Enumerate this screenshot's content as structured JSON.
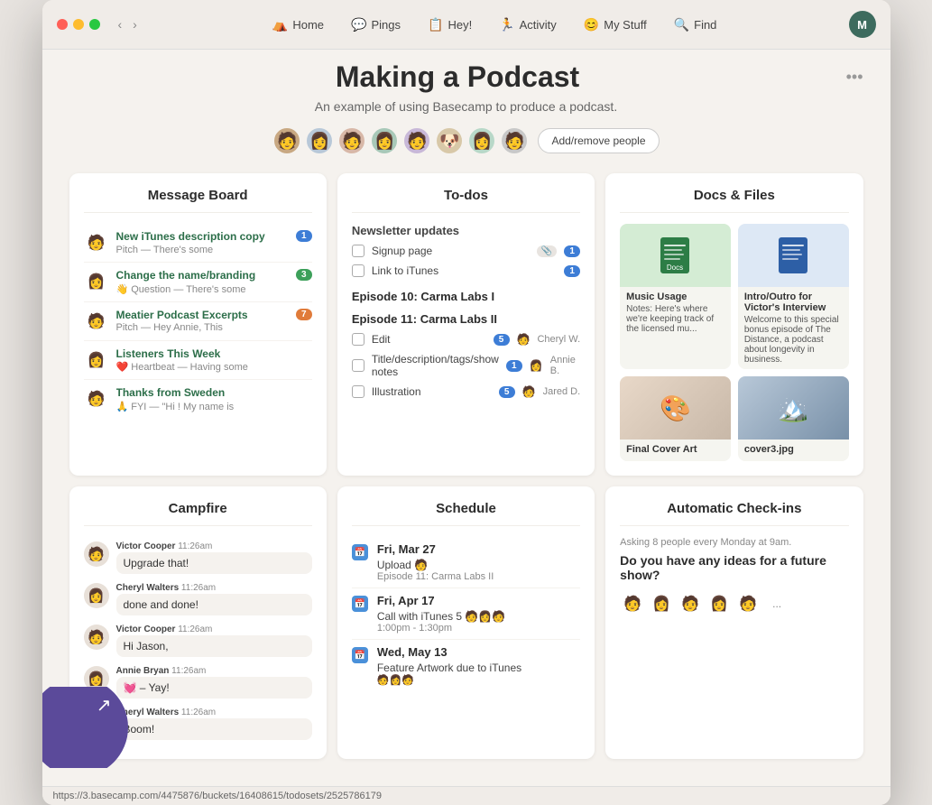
{
  "window": {
    "title": "Making a Podcast"
  },
  "titlebar": {
    "nav_back": "‹",
    "nav_forward": "›",
    "nav_items": [
      {
        "id": "home",
        "icon": "⛺",
        "label": "Home"
      },
      {
        "id": "pings",
        "icon": "💬",
        "label": "Pings"
      },
      {
        "id": "hey",
        "icon": "📋",
        "label": "Hey!"
      },
      {
        "id": "activity",
        "icon": "🏃",
        "label": "Activity"
      },
      {
        "id": "mystuff",
        "icon": "😊",
        "label": "My Stuff"
      },
      {
        "id": "find",
        "icon": "🔍",
        "label": "Find"
      }
    ],
    "avatar_initial": "M"
  },
  "project": {
    "title": "Making a Podcast",
    "subtitle": "An example of using Basecamp to produce a podcast.",
    "add_people_label": "Add/remove people"
  },
  "message_board": {
    "title": "Message Board",
    "items": [
      {
        "title": "New iTunes description copy",
        "sub": "Pitch — There's some",
        "badge": "1",
        "badge_color": "blue",
        "emoji": "🧑"
      },
      {
        "title": "Change the name/branding",
        "sub": "👋 Question — There's some",
        "badge": "3",
        "badge_color": "green",
        "emoji": "👩"
      },
      {
        "title": "Meatier Podcast Excerpts",
        "sub": "Pitch — Hey Annie, This",
        "badge": "7",
        "badge_color": "orange",
        "emoji": "🧑"
      },
      {
        "title": "Listeners This Week",
        "sub": "❤️ Heartbeat — Having some",
        "badge": "",
        "badge_color": "",
        "emoji": "👩"
      },
      {
        "title": "Thanks from Sweden",
        "sub": "🙏 FYI — \"Hi ! My name is",
        "badge": "",
        "badge_color": "",
        "emoji": "🧑"
      }
    ]
  },
  "todos": {
    "title": "To-dos",
    "sections": [
      {
        "name": "Newsletter updates",
        "items": [
          {
            "label": "Signup page",
            "checked": false,
            "badge": "1"
          },
          {
            "label": "Link to iTunes",
            "checked": false,
            "badge": "1"
          }
        ]
      },
      {
        "name": "Episode 10: Carma Labs I",
        "items": []
      },
      {
        "name": "Episode 11: Carma Labs II",
        "items": [
          {
            "label": "Edit",
            "checked": false,
            "badge": "5",
            "assignee": "🧑"
          },
          {
            "label": "Title/description/tags/show notes",
            "checked": false,
            "badge": "1",
            "assignee": "👩"
          },
          {
            "label": "Illustration",
            "checked": false,
            "badge": "5",
            "assignee": "🧑"
          }
        ]
      }
    ]
  },
  "docs_files": {
    "title": "Docs & Files",
    "items": [
      {
        "name": "Music Usage",
        "type": "doc",
        "icon": "📄",
        "sub": "Notes: Here's where we're keeping track of the licensed mu...",
        "thumb_color": "green"
      },
      {
        "name": "Intro/Outro for Victor's Interview",
        "type": "doc",
        "icon": "📄",
        "sub": "Welcome to this special bonus episode of The Distance, a podcast about longevity in business. Annie Bryn will be ...",
        "thumb_color": "blue"
      },
      {
        "name": "Final Cover Art",
        "type": "image",
        "icon": "🖼️",
        "sub": "",
        "thumb_color": "img"
      },
      {
        "name": "cover3.jpg",
        "type": "image",
        "icon": "🏔️",
        "sub": "",
        "thumb_color": "img"
      }
    ]
  },
  "campfire": {
    "title": "Campfire",
    "messages": [
      {
        "name": "Victor Cooper",
        "time": "11:26am",
        "msg": "Upgrade that!",
        "emoji": "🧑"
      },
      {
        "name": "Cheryl Walters",
        "time": "11:26am",
        "msg": "done and done!",
        "emoji": "👩"
      },
      {
        "name": "Victor Cooper",
        "time": "11:26am",
        "msg": "Hi Jason,",
        "emoji": "🧑"
      },
      {
        "name": "Annie Bryan",
        "time": "11:26am",
        "msg": "💓 – Yay!",
        "emoji": "👩"
      },
      {
        "name": "Cheryl Walters",
        "time": "11:26am",
        "msg": "Boom!",
        "emoji": "👩"
      }
    ]
  },
  "schedule": {
    "title": "Schedule",
    "events": [
      {
        "date": "Fri, Mar 27",
        "items": [
          {
            "label": "Upload 🧑",
            "sub": "Episode 11: Carma Labs II"
          }
        ]
      },
      {
        "date": "Fri, Apr 17",
        "items": [
          {
            "label": "Call with iTunes 5 🧑👩🧑",
            "sub": "1:00pm - 1:30pm"
          }
        ]
      },
      {
        "date": "Wed, May 13",
        "items": [
          {
            "label": "Feature Artwork due to iTunes",
            "sub": "🧑👩🧑"
          }
        ]
      }
    ]
  },
  "checkins": {
    "title": "Automatic Check-ins",
    "asking": "Asking 8 people every Monday at 9am.",
    "question": "Do you have any ideas for a future show?",
    "avatars": [
      "🧑",
      "👩",
      "🧑",
      "👩",
      "🧑",
      "..."
    ]
  },
  "bottom_url": "https://3.basecamp.com/4475876/buckets/16408615/todosets/2525786179"
}
